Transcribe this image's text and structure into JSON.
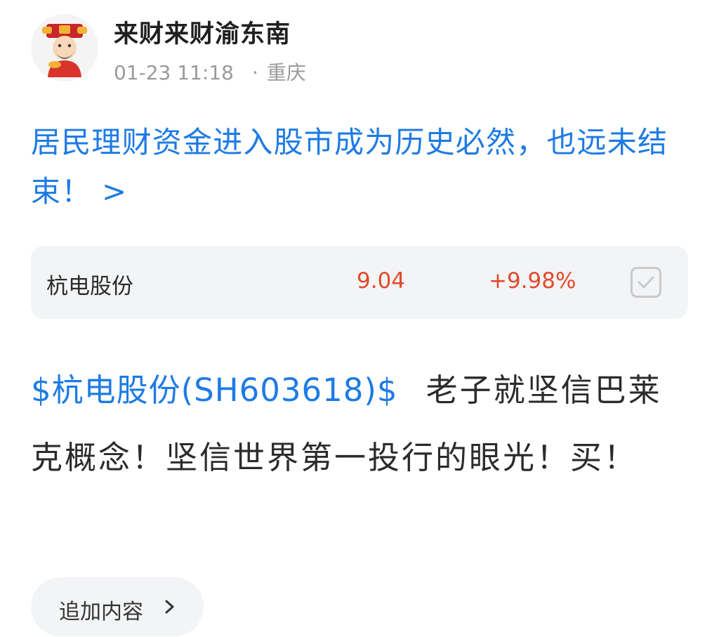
{
  "post": {
    "author": {
      "name": "来财来财渝东南",
      "avatar_icon": "god-of-wealth-avatar-icon"
    },
    "time": "01-23 11:18",
    "dot": "·",
    "location": "重庆",
    "title_link": "居民理财资金进入股市成为历史必然，也远未结束！ >",
    "stock": {
      "name": "杭电股份",
      "price": "9.04",
      "change": "+9.98%",
      "check_icon": "checkbox-icon"
    },
    "body": {
      "stock_tag": "$杭电股份(SH603618)$",
      "text": "老子就坚信巴莱克概念！坚信世界第一投行的眼光！买！"
    },
    "append_button": {
      "label": "追加内容",
      "icon": "chevron-right-icon"
    }
  },
  "colors": {
    "link": "#1e7be4",
    "rise": "#e14a2b",
    "muted": "#9a9a9a",
    "card_bg": "#f3f4f6"
  }
}
